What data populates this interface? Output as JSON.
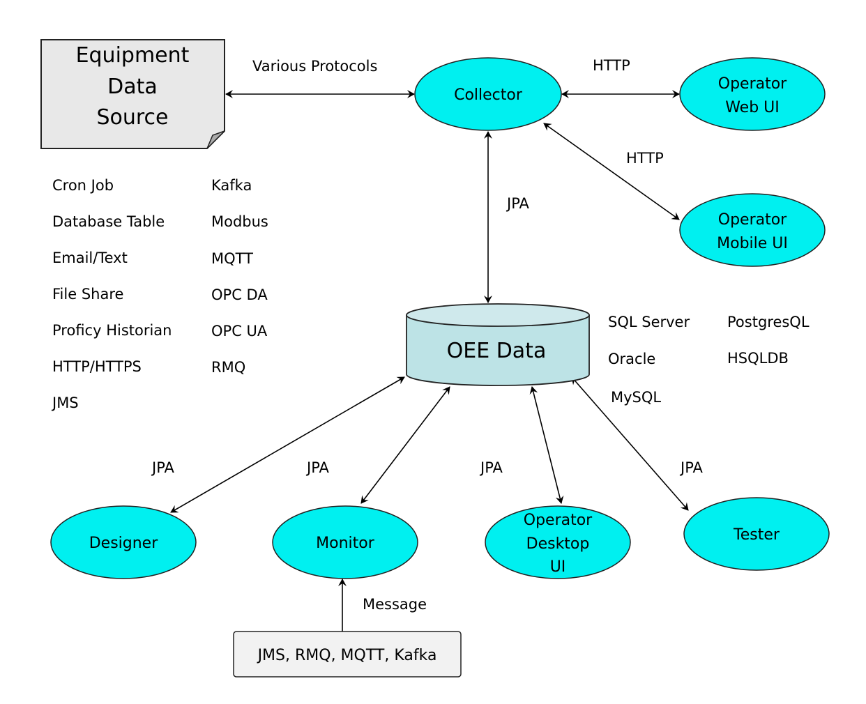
{
  "colors": {
    "node_fill": "#00f0f0",
    "database_fill": "#bde3e6",
    "database_top": "#cfe9ec",
    "source_fill": "#e8e8e8",
    "message_box_fill": "#f2f2f2"
  },
  "source": {
    "lines": [
      "Equipment",
      "Data",
      "Source"
    ]
  },
  "collector": {
    "label": "Collector"
  },
  "operator_web": {
    "lines": [
      "Operator",
      "Web UI"
    ]
  },
  "operator_mobile": {
    "lines": [
      "Operator",
      "Mobile UI"
    ]
  },
  "database": {
    "label": "OEE Data"
  },
  "designer": {
    "label": "Designer"
  },
  "monitor": {
    "label": "Monitor"
  },
  "operator_desktop": {
    "lines": [
      "Operator",
      "Desktop",
      "UI"
    ]
  },
  "tester": {
    "label": "Tester"
  },
  "message_box": {
    "label": "JMS, RMQ, MQTT, Kafka"
  },
  "edge_labels": {
    "various_protocols": "Various Protocols",
    "http_web": "HTTP",
    "http_mobile": "HTTP",
    "jpa_collector": "JPA",
    "jpa_designer": "JPA",
    "jpa_monitor": "JPA",
    "jpa_desktop": "JPA",
    "jpa_tester": "JPA",
    "message": "Message"
  },
  "protocols_col1": [
    "Cron  Job",
    "Database Table",
    "Email/Text",
    "File Share",
    "Proficy Historian",
    "HTTP/HTTPS",
    "JMS"
  ],
  "protocols_col2": [
    "Kafka",
    "Modbus",
    "MQTT",
    "OPC DA",
    "OPC UA",
    "RMQ"
  ],
  "databases_col1": [
    "SQL Server",
    "Oracle",
    "MySQL"
  ],
  "databases_col2": [
    "PostgresQL",
    "HSQLDB"
  ]
}
